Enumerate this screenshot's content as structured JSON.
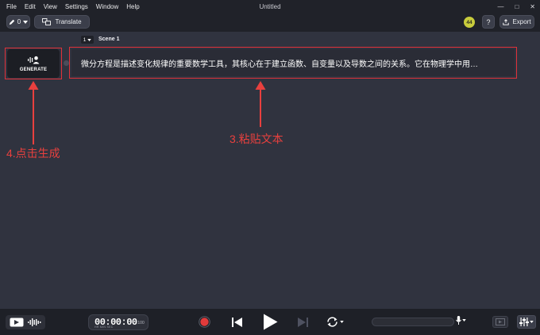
{
  "menubar": {
    "items": [
      "File",
      "Edit",
      "View",
      "Settings",
      "Window",
      "Help"
    ],
    "title": "Untitled"
  },
  "toolbar": {
    "voice_count": "0",
    "translate_label": "Translate",
    "credits": "44",
    "help_label": "?",
    "export_label": "Export"
  },
  "scene": {
    "number": "1",
    "label": "Scene 1",
    "generate_label": "GENERATE",
    "text": "微分方程是描述变化规律的重要数学工具，其核心在于建立函数、自变量以及导数之间的关系。它在物理学中用…"
  },
  "annotations": {
    "generate_hint": "4.点击生成",
    "text_hint": "3.粘贴文本"
  },
  "playback": {
    "timecode": "00:00:00",
    "timecode_fraction": ".100",
    "timecode_units": "HR   MIN   SEC"
  },
  "colors": {
    "accent_red": "#e0323a",
    "record": "#e23b3b",
    "credit_badge": "#c8cc3c"
  },
  "icons": [
    "pen-icon",
    "translate-icon",
    "help-icon",
    "export-icon",
    "voice-wave-icon",
    "video-icon",
    "waveform-icon",
    "record-icon",
    "skip-back-icon",
    "play-icon",
    "skip-forward-icon",
    "loop-icon",
    "mic-icon",
    "subtitle-icon",
    "tune-icon"
  ]
}
